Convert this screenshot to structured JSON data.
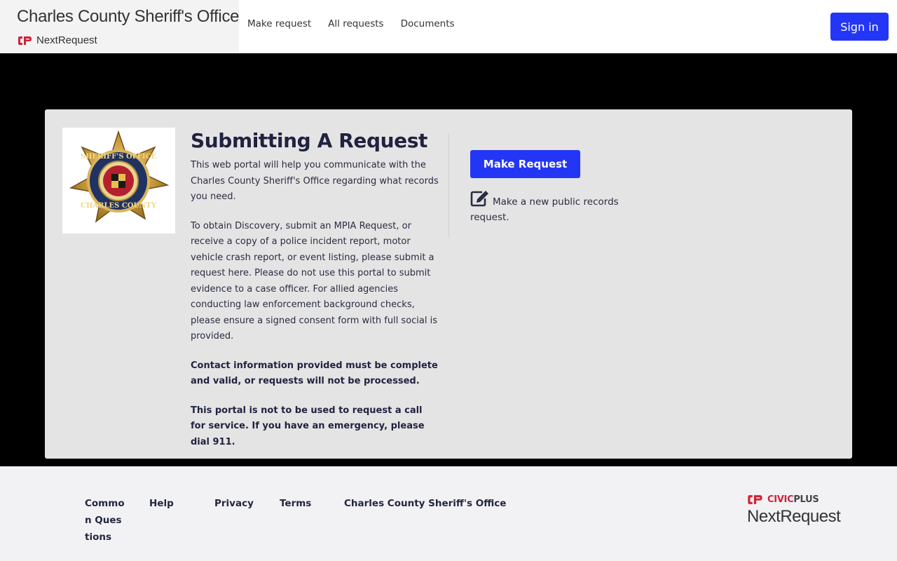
{
  "header": {
    "agency_name": "Charles County Sheriff's Office",
    "product_name": "NextRequest",
    "nav": [
      {
        "label": "Make request"
      },
      {
        "label": "All requests"
      },
      {
        "label": "Documents"
      }
    ],
    "sign_in_label": "Sign in"
  },
  "main": {
    "badge_icon": "sheriff-star-badge",
    "title": "Submitting A Request",
    "paragraphs": [
      "This web portal will help you communicate with the Charles County Sheriff's Office regarding what records you need.",
      "To obtain Discovery, submit an MPIA Request, or receive a copy of a police incident report, motor vehicle crash report, or event listing, please submit a request here. Please do not use this portal to submit evidence to a case officer. For allied agencies conducting law enforcement background checks, please ensure a signed consent form with full social is provided."
    ],
    "notices": [
      "Contact information provided must be complete and valid, or requests will not be processed.",
      "This portal is not to be used to request a call for service. If you have an emergency, please dial 911."
    ],
    "make_request_label": "Make Request",
    "make_request_desc": "Make a new public records request.",
    "icon": "edit-icon"
  },
  "footer": {
    "links": [
      {
        "label": "Common Questions"
      },
      {
        "label": "Help"
      },
      {
        "label": "Privacy"
      },
      {
        "label": "Terms"
      },
      {
        "label": "Charles County Sheriff's Office"
      }
    ],
    "civic_brand_a": "CIVIC",
    "civic_brand_b": "PLUS",
    "footer_product": "NextRequest"
  },
  "colors": {
    "accent": "#2436f5",
    "brand_red": "#d32136",
    "page_bg": "#000000",
    "card_bg": "#e4e4e4",
    "text_dark": "#1f2340"
  }
}
